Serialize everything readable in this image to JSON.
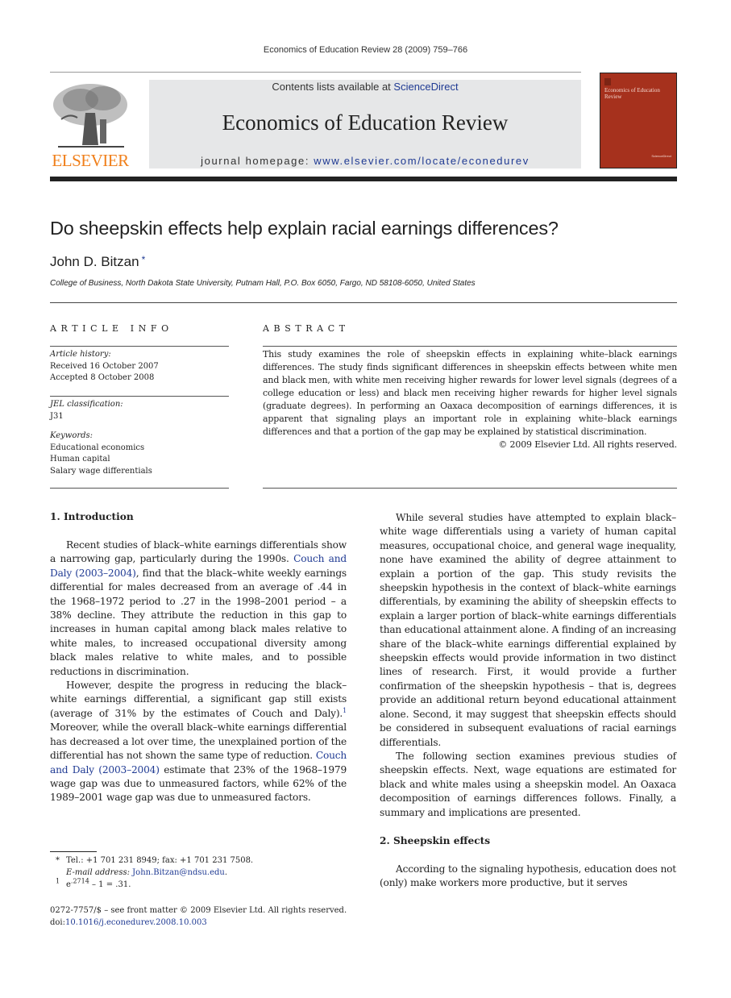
{
  "running_head": "Economics of Education Review 28 (2009) 759–766",
  "masthead": {
    "publisher_logo": "ELSEVIER",
    "contents_prefix": "Contents lists available at ",
    "contents_link": "ScienceDirect",
    "journal_title": "Economics of Education Review",
    "homepage_prefix": "journal homepage: ",
    "homepage_link": "www.elsevier.com/locate/econedurev",
    "cover_title": "Economics of Education Review",
    "cover_badge": "ScienceDirect",
    "colors": {
      "publisher_orange": "#f07f1a",
      "cover_red": "#a6311d",
      "link_blue": "#1f3a93",
      "masthead_gray": "#e6e7e8"
    }
  },
  "article": {
    "title": "Do sheepskin effects help explain racial earnings differences?",
    "author": "John D. Bitzan",
    "author_mark": "*",
    "affiliation": "College of Business, North Dakota State University, Putnam Hall, P.O. Box 6050, Fargo, ND 58108-6050, United States"
  },
  "article_info": {
    "heading": "ARTICLE INFO",
    "history_label": "Article history:",
    "received": "Received 16 October 2007",
    "accepted": "Accepted 8 October 2008",
    "jel_label": "JEL classification:",
    "jel_code": "J31",
    "keywords_label": "Keywords:",
    "keywords": [
      "Educational economics",
      "Human capital",
      "Salary wage differentials"
    ]
  },
  "abstract": {
    "heading": "ABSTRACT",
    "text": "This study examines the role of sheepskin effects in explaining white–black earnings differences. The study finds significant differences in sheepskin effects between white men and black men, with white men receiving higher rewards for lower level signals (degrees of a college education or less) and black men receiving higher rewards for higher level signals (graduate degrees). In performing an Oaxaca decomposition of earnings differences, it is apparent that signaling plays an important role in explaining white–black earnings differences and that a portion of the gap may be explained by statistical discrimination.",
    "copyright": "© 2009 Elsevier Ltd. All rights reserved."
  },
  "sections": {
    "intro_heading": "1.  Introduction",
    "intro_p1_a": "Recent studies of black–white earnings differentials show a narrowing gap, particularly during the 1990s. ",
    "intro_p1_link": "Couch and Daly (2003–2004)",
    "intro_p1_b": ", find that the black–white weekly earnings differential for males decreased from an average of .44 in the 1968–1972 period to .27 in the 1998–2001 period – a 38% decline. They attribute the reduction in this gap to increases in human capital among black males relative to white males, to increased occupational diversity among black males relative to white males, and to possible reductions in discrimination.",
    "intro_p2_a": "However, despite the progress in reducing the black–white earnings differential, a significant gap still exists (average of 31% by the estimates of Couch and Daly).",
    "intro_p2_fn": "1",
    "intro_p2_b": " Moreover, while the overall black–white earnings differential has decreased a lot over time, the unexplained portion of the differential has not shown the same type of reduction. ",
    "intro_p2_link": "Couch and Daly (2003–2004)",
    "intro_p2_c": " estimate that 23% of the 1968–1979 wage gap was due to unmeasured factors, while 62% of the 1989–2001 wage gap was due to unmeasured factors.",
    "intro_p3": "While several studies have attempted to explain black–white wage differentials using a variety of human capital measures, occupational choice, and general wage inequality, none have examined the ability of degree attainment to explain a portion of the gap. This study revisits the sheepskin hypothesis in the context of black–white earnings differentials, by examining the ability of sheepskin effects to explain a larger portion of black–white earnings differentials than educational attainment alone. A finding of an increasing share of the black–white earnings differential explained by sheepskin effects would provide information in two distinct lines of research. First, it would provide a further confirmation of the sheepskin hypothesis – that is, degrees provide an additional return beyond educational attainment alone. Second, it may suggest that sheepskin effects should be considered in subsequent evaluations of racial earnings differentials.",
    "intro_p4": "The following section examines previous studies of sheepskin effects. Next, wage equations are estimated for black and white males using a sheepskin model. An Oaxaca decomposition of earnings differences follows. Finally, a summary and implications are presented.",
    "sheepskin_heading": "2.  Sheepskin effects",
    "sheepskin_p1": "According to the signaling hypothesis, education does not (only) make workers more productive, but it serves"
  },
  "footnotes": {
    "star_mark": "*",
    "contact": "Tel.: +1 701 231 8949; fax: +1 701 231 7508.",
    "email_label": "E-mail address: ",
    "email": "John.Bitzan@ndsu.edu",
    "email_suffix": ".",
    "fn1_mark": "1",
    "fn1_base": "e",
    "fn1_exp": ".2714",
    "fn1_rest": " – 1 = .31."
  },
  "front_matter": {
    "issn_line": "0272-7757/$ – see front matter © 2009 Elsevier Ltd. All rights reserved.",
    "doi_label": "doi:",
    "doi": "10.1016/j.econedurev.2008.10.003"
  }
}
